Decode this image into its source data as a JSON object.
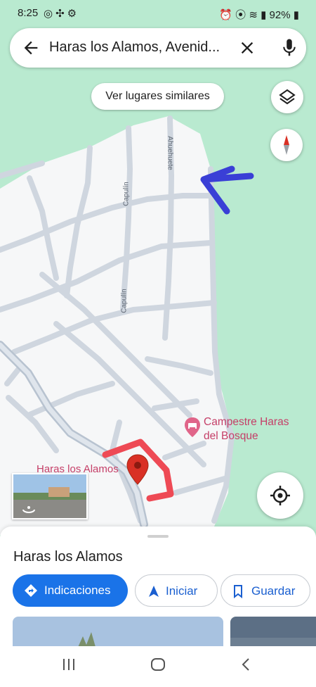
{
  "status_bar": {
    "time": "8:25",
    "battery": "92%"
  },
  "search": {
    "query": "Haras los Alamos, Avenid...",
    "back_icon": "arrow-left-icon",
    "clear_icon": "close-icon",
    "mic_icon": "microphone-icon"
  },
  "map": {
    "chip_label": "Ver lugares similares",
    "street_labels": [
      "Ahuehuete",
      "Capulín",
      "Capulín"
    ],
    "poi": {
      "name_line1": "Campestre Haras",
      "name_line2": "del Bosque"
    },
    "pin_label": "Haras los Alamos",
    "colors": {
      "park": "#b9ead0",
      "land": "#f6f7f8",
      "road": "#cfd6df",
      "annotation_blue": "#3a3fd6",
      "annotation_red": "#ee4a55",
      "pin": "#d93025"
    }
  },
  "place_sheet": {
    "title": "Haras los Alamos",
    "buttons": {
      "directions": "Indicaciones",
      "start": "Iniciar",
      "save": "Guardar"
    }
  }
}
